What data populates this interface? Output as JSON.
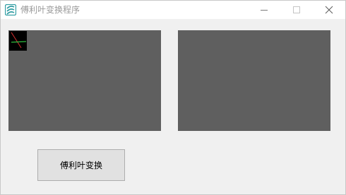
{
  "window": {
    "title": "傅利叶变换程序"
  },
  "titlebar_buttons": {
    "minimize_icon": "minimize-icon",
    "maximize_icon": "maximize-icon",
    "close_icon": "close-icon"
  },
  "main": {
    "transform_button_label": "傅利叶变换"
  },
  "colors": {
    "panel_background": "#5f5f5f",
    "window_background": "#f0f0f0",
    "app_icon_accent": "#2a9aa0"
  }
}
